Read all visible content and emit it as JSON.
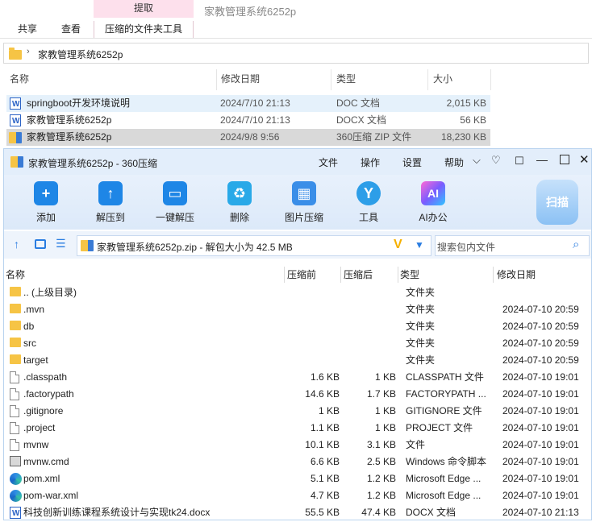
{
  "ribbon": {
    "context_tab": "提取",
    "title": "家教管理系统6252p",
    "tabs": [
      "共享",
      "查看",
      "压缩的文件夹工具"
    ]
  },
  "address": {
    "path": "家教管理系统6252p"
  },
  "explorer": {
    "columns": [
      "名称",
      "修改日期",
      "类型",
      "大小"
    ],
    "rows": [
      {
        "name": "springboot开发环境说明",
        "date": "2024/7/10 21:13",
        "type": "DOC 文档",
        "size": "2,015 KB",
        "icon": "word-doc-icon"
      },
      {
        "name": "家教管理系统6252p",
        "date": "2024/7/10 21:13",
        "type": "DOCX 文档",
        "size": "56 KB",
        "icon": "word-doc-icon"
      },
      {
        "name": "家教管理系统6252p",
        "date": "2024/9/8 9:56",
        "type": "360压缩 ZIP 文件",
        "size": "18,230 KB",
        "icon": "zip-icon"
      }
    ]
  },
  "archive": {
    "title": "家教管理系统6252p - 360压缩",
    "menu": [
      "文件",
      "操作",
      "设置",
      "帮助"
    ],
    "tools": [
      "添加",
      "解压到",
      "一键解压",
      "删除",
      "图片压缩",
      "工具",
      "AI办公"
    ],
    "scan_label": "扫描",
    "path": "家教管理系统6252p.zip - 解包大小为 42.5 MB",
    "search_placeholder": "搜索包内文件",
    "columns": [
      "名称",
      "压缩前",
      "压缩后",
      "类型",
      "修改日期"
    ],
    "rows": [
      {
        "name": ".. (上级目录)",
        "before": "",
        "after": "",
        "type": "文件夹",
        "date": "",
        "icon": "folder-icon"
      },
      {
        "name": ".mvn",
        "before": "",
        "after": "",
        "type": "文件夹",
        "date": "2024-07-10 20:59",
        "icon": "folder-icon"
      },
      {
        "name": "db",
        "before": "",
        "after": "",
        "type": "文件夹",
        "date": "2024-07-10 20:59",
        "icon": "folder-icon"
      },
      {
        "name": "src",
        "before": "",
        "after": "",
        "type": "文件夹",
        "date": "2024-07-10 20:59",
        "icon": "folder-icon"
      },
      {
        "name": "target",
        "before": "",
        "after": "",
        "type": "文件夹",
        "date": "2024-07-10 20:59",
        "icon": "folder-icon"
      },
      {
        "name": ".classpath",
        "before": "1.6 KB",
        "after": "1 KB",
        "type": "CLASSPATH 文件",
        "date": "2024-07-10 19:01",
        "icon": "file-icon"
      },
      {
        "name": ".factorypath",
        "before": "14.6 KB",
        "after": "1.7 KB",
        "type": "FACTORYPATH ...",
        "date": "2024-07-10 19:01",
        "icon": "file-icon"
      },
      {
        "name": ".gitignore",
        "before": "1 KB",
        "after": "1 KB",
        "type": "GITIGNORE 文件",
        "date": "2024-07-10 19:01",
        "icon": "file-icon"
      },
      {
        "name": ".project",
        "before": "1.1 KB",
        "after": "1 KB",
        "type": "PROJECT 文件",
        "date": "2024-07-10 19:01",
        "icon": "file-icon"
      },
      {
        "name": "mvnw",
        "before": "10.1 KB",
        "after": "3.1 KB",
        "type": "文件",
        "date": "2024-07-10 19:01",
        "icon": "file-icon"
      },
      {
        "name": "mvnw.cmd",
        "before": "6.6 KB",
        "after": "2.5 KB",
        "type": "Windows 命令脚本",
        "date": "2024-07-10 19:01",
        "icon": "cmd-icon"
      },
      {
        "name": "pom.xml",
        "before": "5.1 KB",
        "after": "1.2 KB",
        "type": "Microsoft Edge ...",
        "date": "2024-07-10 19:01",
        "icon": "edge-icon"
      },
      {
        "name": "pom-war.xml",
        "before": "4.7 KB",
        "after": "1.2 KB",
        "type": "Microsoft Edge ...",
        "date": "2024-07-10 19:01",
        "icon": "edge-icon"
      },
      {
        "name": "科技创新训练课程系统设计与实现tk24.docx",
        "before": "55.5 KB",
        "after": "47.4 KB",
        "type": "DOCX 文档",
        "date": "2024-07-10 21:13",
        "icon": "word-doc-icon"
      }
    ]
  }
}
